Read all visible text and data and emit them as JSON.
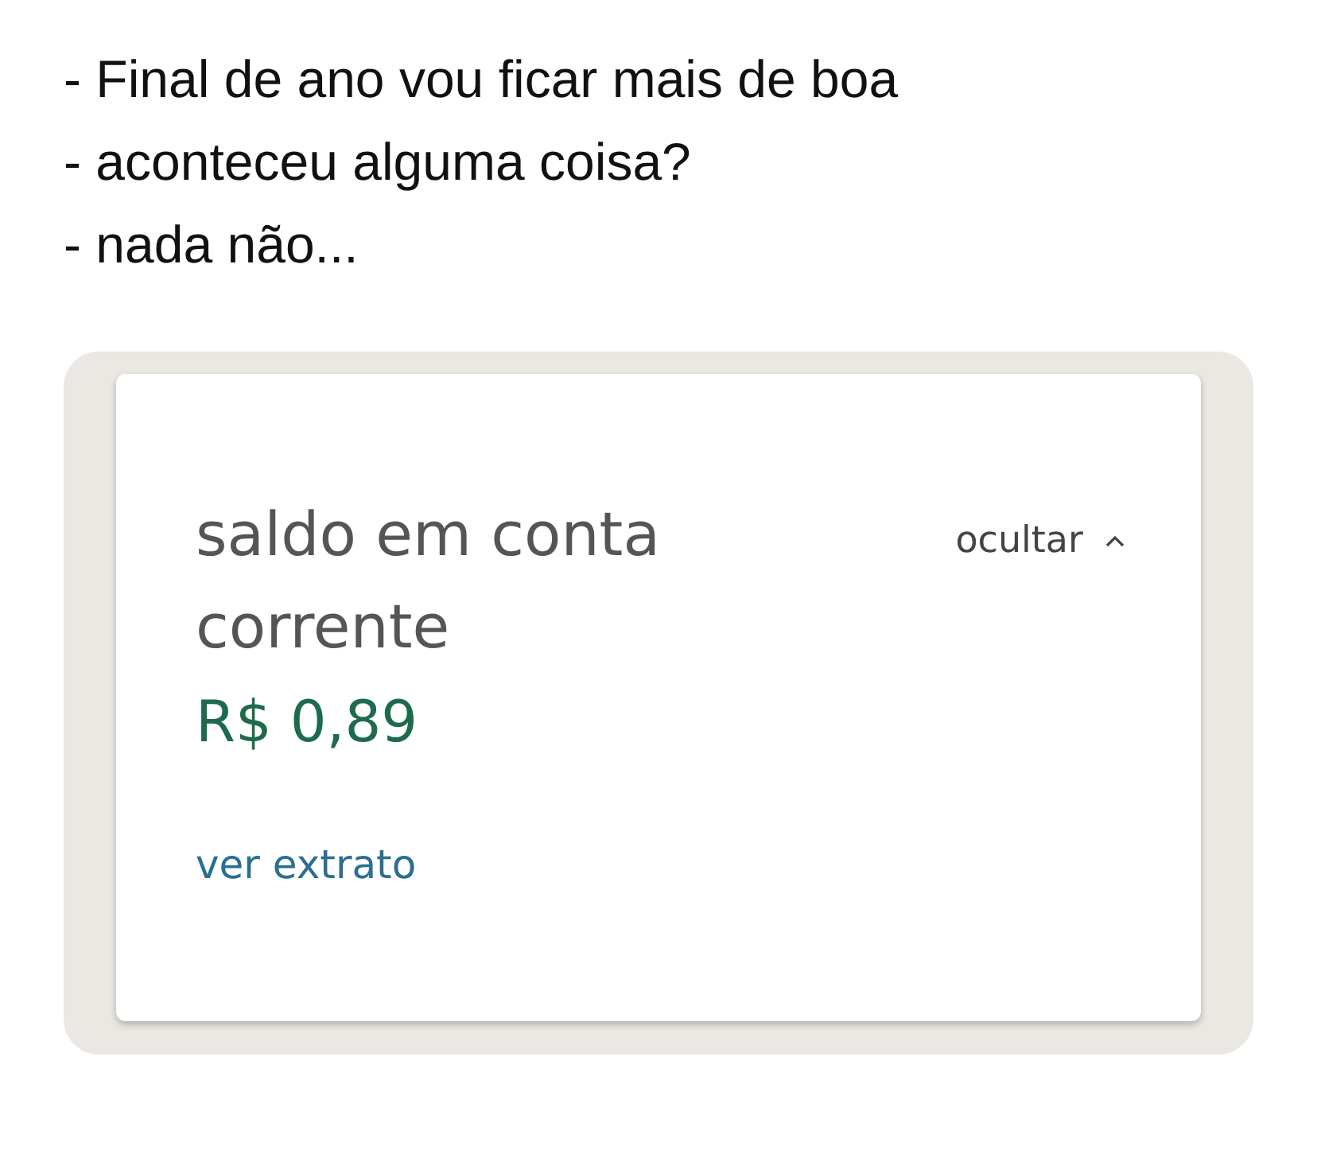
{
  "caption_lines": [
    "- Final de ano vou ficar mais de boa",
    "- aconteceu alguma coisa?",
    "- nada não..."
  ],
  "balance_card": {
    "title": "saldo em conta corrente",
    "toggle": {
      "label": "ocultar",
      "expanded": true
    },
    "amount": "R$ 0,89",
    "link": "ver extrato"
  }
}
